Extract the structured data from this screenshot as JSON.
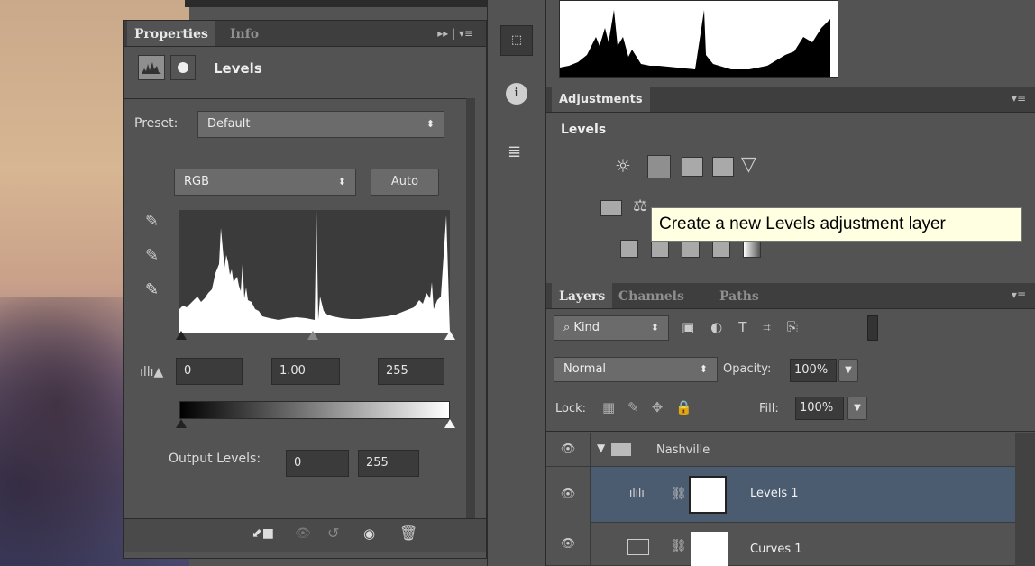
{
  "properties_panel": {
    "tabs": [
      "Properties",
      "Info"
    ],
    "title": "Levels",
    "preset_label": "Preset:",
    "preset_value": "Default",
    "channel_value": "RGB",
    "auto_label": "Auto",
    "input_black": "0",
    "input_gamma": "1.00",
    "input_white": "255",
    "output_label": "Output Levels:",
    "output_black": "0",
    "output_white": "255"
  },
  "adjustments_panel": {
    "tab": "Adjustments",
    "heading": "Levels",
    "tooltip": "Create a new Levels adjustment layer"
  },
  "layers_panel": {
    "tabs": [
      "Layers",
      "Channels",
      "Paths"
    ],
    "filter_kind": "Kind",
    "blend_mode": "Normal",
    "opacity_label": "Opacity:",
    "opacity_value": "100%",
    "lock_label": "Lock:",
    "fill_label": "Fill:",
    "fill_value": "100%",
    "layers": [
      {
        "name": "Nashville",
        "type": "group"
      },
      {
        "name": "Levels 1",
        "type": "levels",
        "selected": true
      },
      {
        "name": "Curves 1",
        "type": "curves"
      }
    ]
  },
  "colors": {
    "panel_bg": "#535353",
    "selected_row": "#4b5b70",
    "tooltip_bg": "#ffffe1"
  }
}
